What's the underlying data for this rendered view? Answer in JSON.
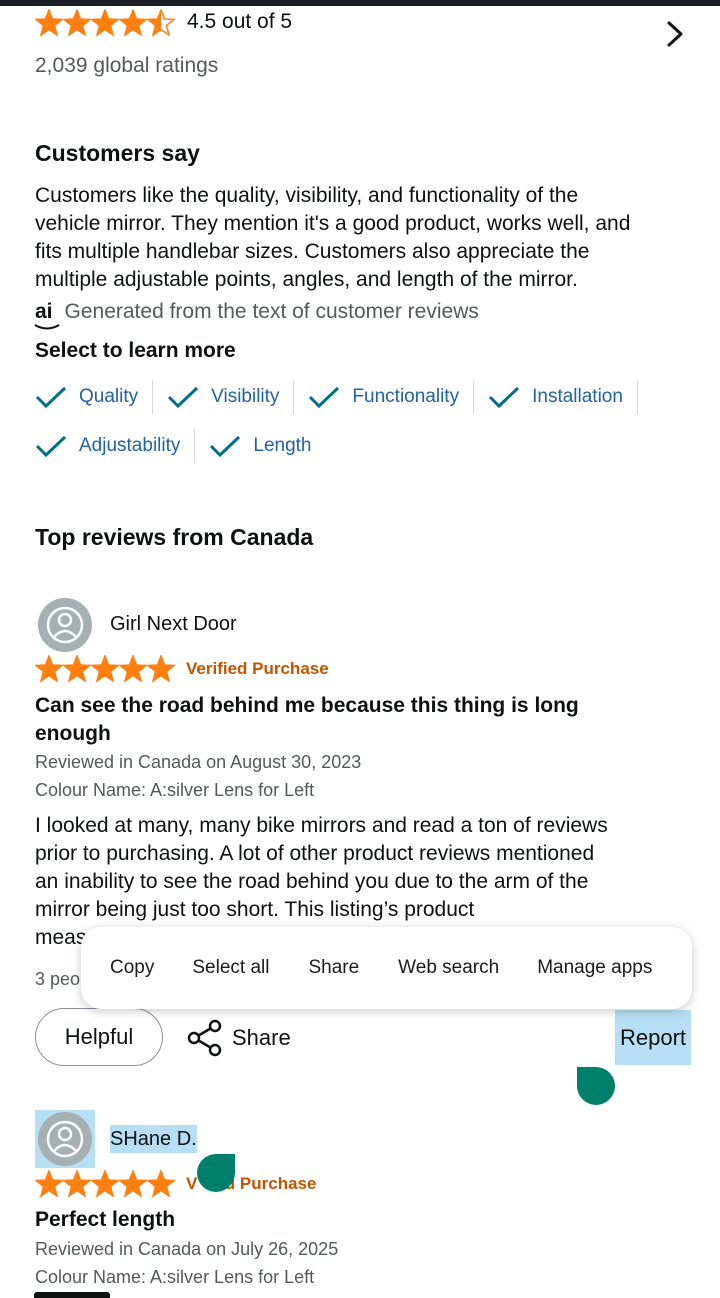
{
  "summary": {
    "rating_text": "4.5 out of 5",
    "rating_value": 4.5,
    "global_ratings": "2,039 global ratings"
  },
  "customers_say": {
    "title": "Customers say",
    "line1": "Customers like the quality, visibility, and functionality of the",
    "line2": "vehicle mirror. They mention it's a good product, works well, and",
    "line3": "fits multiple handlebar sizes. Customers also appreciate the",
    "line4": "multiple adjustable points, angles, and length of the mirror.",
    "ai_badge": "ai",
    "ai_note": "Generated from the text of customer reviews",
    "select_title": "Select to learn more",
    "aspects": [
      "Quality",
      "Visibility",
      "Functionality",
      "Installation",
      "Adjustability",
      "Length"
    ]
  },
  "top_reviews_title": "Top reviews from Canada",
  "review1": {
    "author": "Girl Next Door",
    "stars": 5,
    "verified": "Verified Purchase",
    "title_line1": "Can see the road behind me because this thing is long",
    "title_line2": "enough",
    "date": "Reviewed in Canada on August 30, 2023",
    "variant": "Colour Name: A:silver Lens for Left",
    "body_line1": "I looked at many, many bike mirrors and read a ton of reviews",
    "body_line2": "prior to purchasing. A lot of other product reviews mentioned",
    "body_line3": "an inability to see the road behind you due to the arm of the",
    "body_line4": "mirror being just too short. This listing’s product",
    "body_line5": "meas",
    "helpful_count": "3 peo",
    "helpful_button": "Helpful",
    "share_button": "Share",
    "report_link": "Report"
  },
  "context_menu": {
    "items": [
      "Copy",
      "Select all",
      "Share",
      "Web search",
      "Manage apps"
    ]
  },
  "review2": {
    "author": "SHane D.",
    "stars": 5,
    "verified": "ed Purchase",
    "verified_prefix": "V",
    "title": "Perfect length",
    "date": "Reviewed in Canada on July 26, 2025",
    "variant": "Colour Name: A:silver Lens for Left"
  },
  "colors": {
    "star": "#ff7f11",
    "link": "#2162a1",
    "check": "#007185",
    "selection": "#b6dff5",
    "handle": "#00806a"
  }
}
